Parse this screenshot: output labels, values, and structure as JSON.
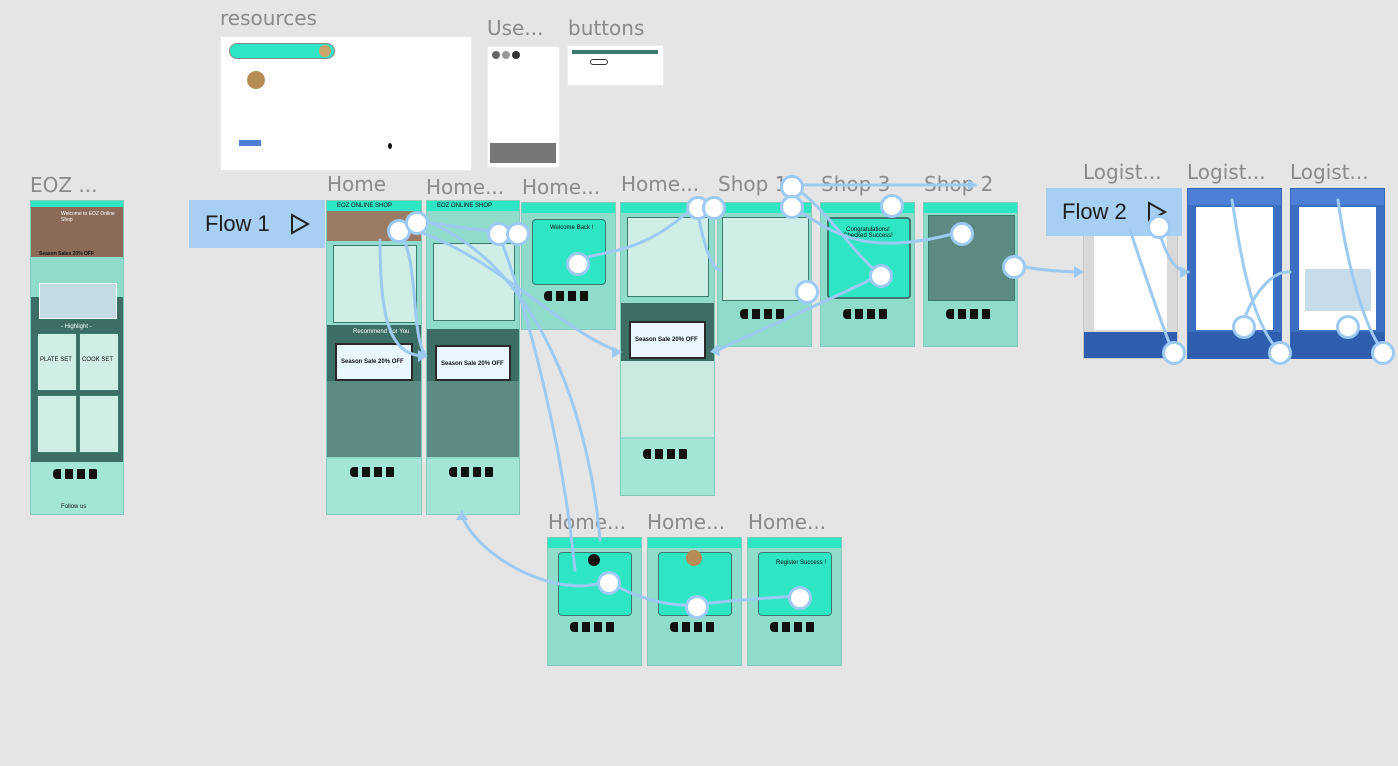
{
  "frames": {
    "resources": "resources",
    "users": "Use...",
    "buttons": "buttons",
    "eoz": "EOZ ...",
    "home": "Home",
    "home2": "Home...",
    "home3": "Home...",
    "home4": "Home...",
    "shop1": "Shop 1",
    "shop3": "Shop 3",
    "shop2": "Shop 2",
    "logist1": "Logist...",
    "logist2": "Logist...",
    "logist3": "Logist...",
    "home_b1": "Home...",
    "home_b2": "Home...",
    "home_b3": "Home..."
  },
  "flows": {
    "flow1": "Flow 1",
    "flow2": "Flow 2"
  },
  "screen_text": {
    "shop_name": "EOZ ONLINE SHOP",
    "welcome": "Welcome to EOZ Online Shop",
    "season_sales": "Season Sales 20% OFF",
    "highlight": "- Highlight -",
    "plate_set": "PLATE SET",
    "cook_set": "COOK SET",
    "recommend": "Recommend For You",
    "promo": "Season Sale 20% OFF",
    "congrats": "Congratulations! Checked Success!",
    "welcome_back": "Welcome Back !",
    "register": "Register Success !",
    "follow_us": "Follow us"
  },
  "colors": {
    "canvas": "#e5e5e5",
    "teal": "#2ee6c4",
    "mint": "#8fdccb",
    "dark_green": "#3c6e66",
    "flow_link": "#9ccaf3",
    "logistics_blue": "#3b6fc2"
  }
}
